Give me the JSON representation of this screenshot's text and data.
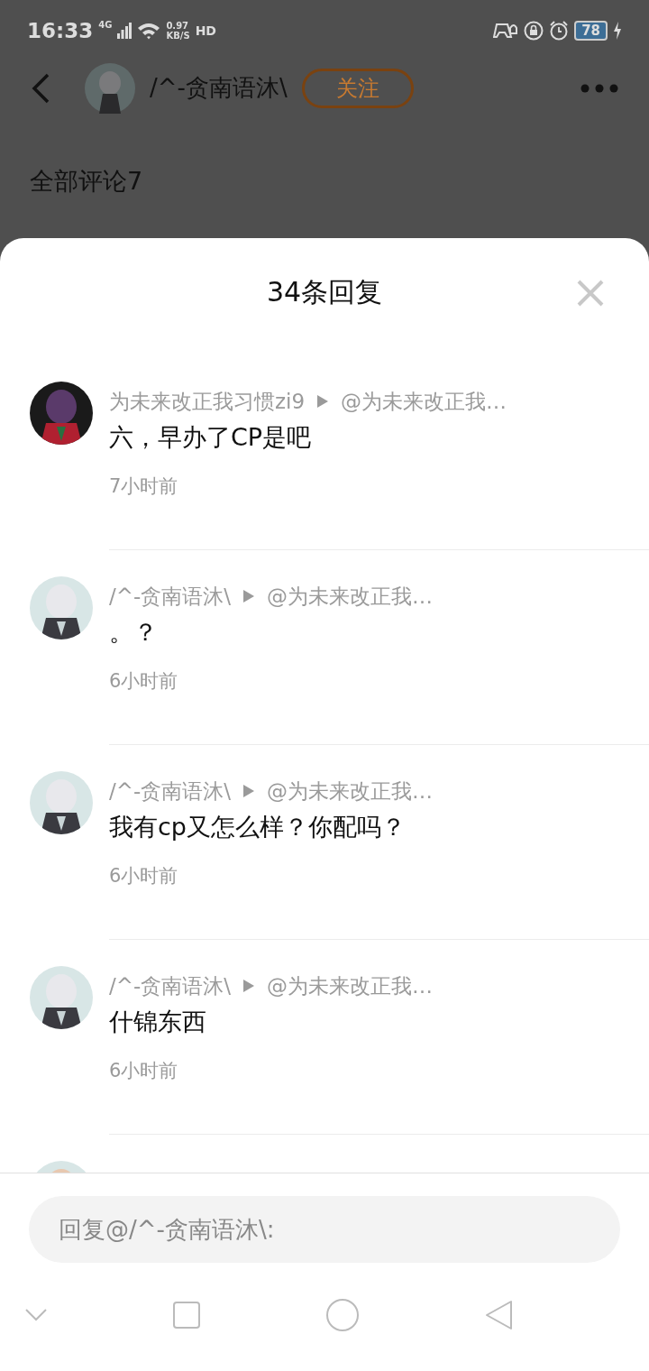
{
  "status_bar": {
    "time": "16:33",
    "network": "4G",
    "speed": "0.97",
    "speed_unit": "KB/S",
    "hd": "HD",
    "battery": "78"
  },
  "header": {
    "username": "/^-贪南语沐\\",
    "follow": "关注"
  },
  "section_title": "全部评论7",
  "sheet": {
    "title": "34条回复"
  },
  "replies": [
    {
      "author": "为未来改正我习惯zi9",
      "target": "@为未来改正我…",
      "content": "六，早办了CP是吧",
      "time": "7小时前"
    },
    {
      "author": "/^-贪南语沐\\",
      "target": "@为未来改正我…",
      "content": "。？",
      "time": "6小时前"
    },
    {
      "author": "/^-贪南语沐\\",
      "target": "@为未来改正我…",
      "content": "我有cp又怎么样？你配吗？",
      "time": "6小时前"
    },
    {
      "author": "/^-贪南语沐\\",
      "target": "@为未来改正我…",
      "content": "什锦东西",
      "time": "6小时前"
    }
  ],
  "reply_field": {
    "placeholder": "回复@/^-贪南语沐\\:"
  }
}
